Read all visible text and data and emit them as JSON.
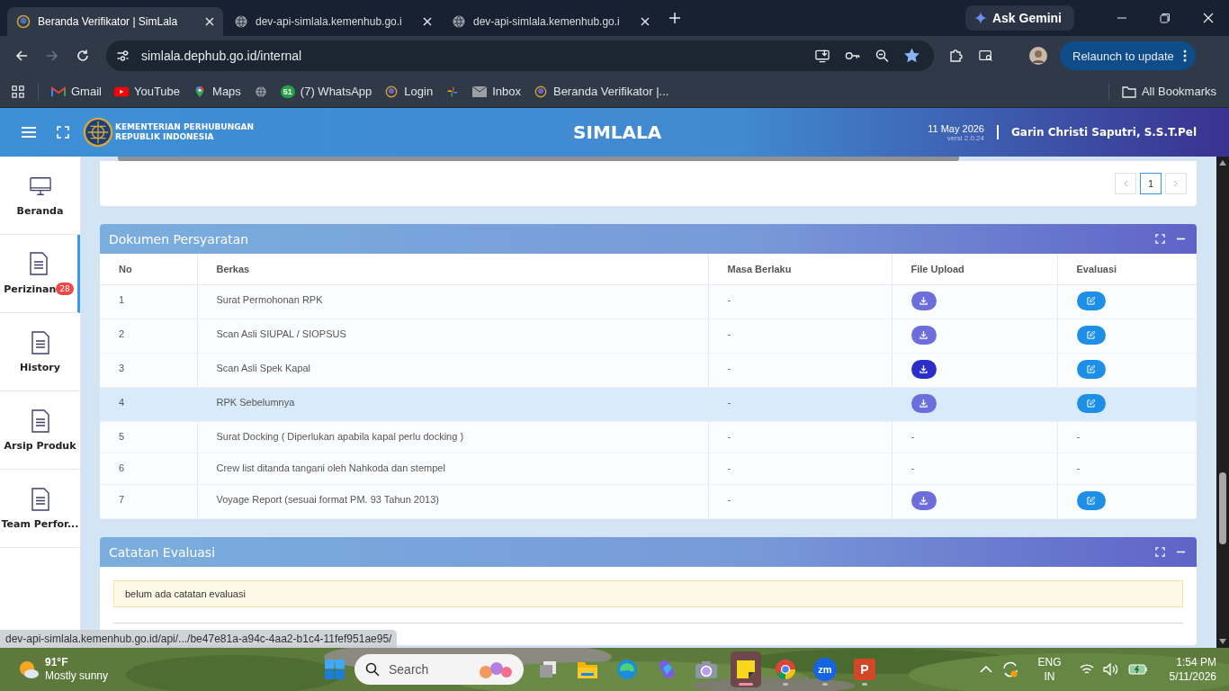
{
  "browser": {
    "tabs": [
      {
        "title": "Beranda Verifikator | SimLala",
        "selected": true
      },
      {
        "title": "dev-api-simlala.kemenhub.go.i",
        "selected": false
      },
      {
        "title": "dev-api-simlala.kemenhub.go.i",
        "selected": false
      }
    ],
    "gemini": "Ask Gemini",
    "url": "simlala.dephub.go.id/internal",
    "bookmarked": true,
    "relaunch": "Relaunch to update",
    "bookmarks": [
      {
        "kind": "apps"
      },
      {
        "kind": "gmail",
        "label": "Gmail"
      },
      {
        "kind": "youtube",
        "label": "YouTube"
      },
      {
        "kind": "maps",
        "label": "Maps"
      },
      {
        "kind": "globe"
      },
      {
        "kind": "whatsapp",
        "badge": "51",
        "label": "(7) WhatsApp"
      },
      {
        "kind": "site",
        "label": "Login"
      },
      {
        "kind": "pinwheel"
      },
      {
        "kind": "mail",
        "label": "Inbox"
      },
      {
        "kind": "site",
        "label": "Beranda Verifikator |..."
      }
    ],
    "all_bookmarks": "All Bookmarks",
    "status_url": "dev-api-simlala.kemenhub.go.id/api/.../be47e81a-a94c-4aa2-b1c4-11fef951ae95/"
  },
  "header": {
    "org": [
      "KEMENTERIAN PERHUBUNGAN",
      "REPUBLIK INDONESIA"
    ],
    "app": "SIMLALA",
    "date": "11 May 2026",
    "version": "versi 2.0.24",
    "user": "Garin Christi Saputri, S.S.T.Pel"
  },
  "sidebar": [
    {
      "kind": "monitor",
      "label": "Beranda",
      "selected": false
    },
    {
      "kind": "document",
      "label": "Perizinan",
      "badge": "28",
      "selected": true
    },
    {
      "kind": "document",
      "label": "History",
      "selected": false
    },
    {
      "kind": "document",
      "label": "Arsip Produk",
      "selected": false
    },
    {
      "kind": "document",
      "label": "Team Perfor...",
      "selected": false
    }
  ],
  "pagination": [
    {
      "label": "1",
      "selected": true
    }
  ],
  "documents": {
    "title": "Dokumen Persyaratan",
    "columns": [
      "No",
      "Berkas",
      "Masa Berlaku",
      "File Upload",
      "Evaluasi"
    ],
    "rows": [
      {
        "no": "1",
        "berkas": "Surat Permohonan RPK",
        "masa": "-",
        "file": {
          "kind": "download",
          "pressed": false
        },
        "eval": {
          "kind": "edit"
        },
        "highlighted": false
      },
      {
        "no": "2",
        "berkas": "Scan Asli SIUPAL / SIOPSUS",
        "masa": "-",
        "file": {
          "kind": "download",
          "pressed": false
        },
        "eval": {
          "kind": "edit"
        },
        "highlighted": false
      },
      {
        "no": "3",
        "berkas": "Scan Asli Spek Kapal",
        "masa": "-",
        "file": {
          "kind": "download",
          "pressed": true
        },
        "eval": {
          "kind": "edit"
        },
        "highlighted": false
      },
      {
        "no": "4",
        "berkas": "RPK Sebelumnya",
        "masa": "-",
        "file": {
          "kind": "download",
          "pressed": false
        },
        "eval": {
          "kind": "edit"
        },
        "highlighted": true
      },
      {
        "no": "5",
        "berkas": "Surat Docking ( Diperlukan apabila kapal perlu docking )",
        "masa": "-",
        "file": {
          "kind": "text",
          "text": "-"
        },
        "eval": {
          "kind": "text",
          "text": "-"
        },
        "highlighted": false
      },
      {
        "no": "6",
        "berkas": "Crew list ditanda tangani oleh Nahkoda dan stempel",
        "masa": "-",
        "file": {
          "kind": "text",
          "text": "-"
        },
        "eval": {
          "kind": "text",
          "text": "-"
        },
        "highlighted": false
      },
      {
        "no": "7",
        "berkas": "Voyage Report (sesuai format PM. 93 Tahun 2013)",
        "masa": "-",
        "file": {
          "kind": "download",
          "pressed": false
        },
        "eval": {
          "kind": "edit"
        },
        "highlighted": false
      }
    ]
  },
  "notes": {
    "title": "Catatan Evaluasi",
    "message": "belum ada catatan evaluasi"
  },
  "taskbar": {
    "weather": {
      "temp": "91°F",
      "text": "Mostly sunny"
    },
    "search": "Search",
    "apps": [
      {
        "kind": "task-view",
        "open": false,
        "selected": false
      },
      {
        "kind": "folder",
        "open": false,
        "selected": false
      },
      {
        "kind": "edge",
        "open": false,
        "selected": false
      },
      {
        "kind": "copilot",
        "open": false,
        "selected": false
      },
      {
        "kind": "camera",
        "open": false,
        "selected": false
      },
      {
        "kind": "sticky",
        "open": true,
        "selected": true
      },
      {
        "kind": "chrome",
        "open": true,
        "selected": false
      },
      {
        "kind": "zoom",
        "label": "zm",
        "open": true,
        "selected": false
      },
      {
        "kind": "powerpoint",
        "label": "P",
        "open": true,
        "selected": false
      }
    ],
    "lang": [
      "ENG",
      "IN"
    ],
    "time": "1:54 PM",
    "date": "5/11/2026"
  }
}
